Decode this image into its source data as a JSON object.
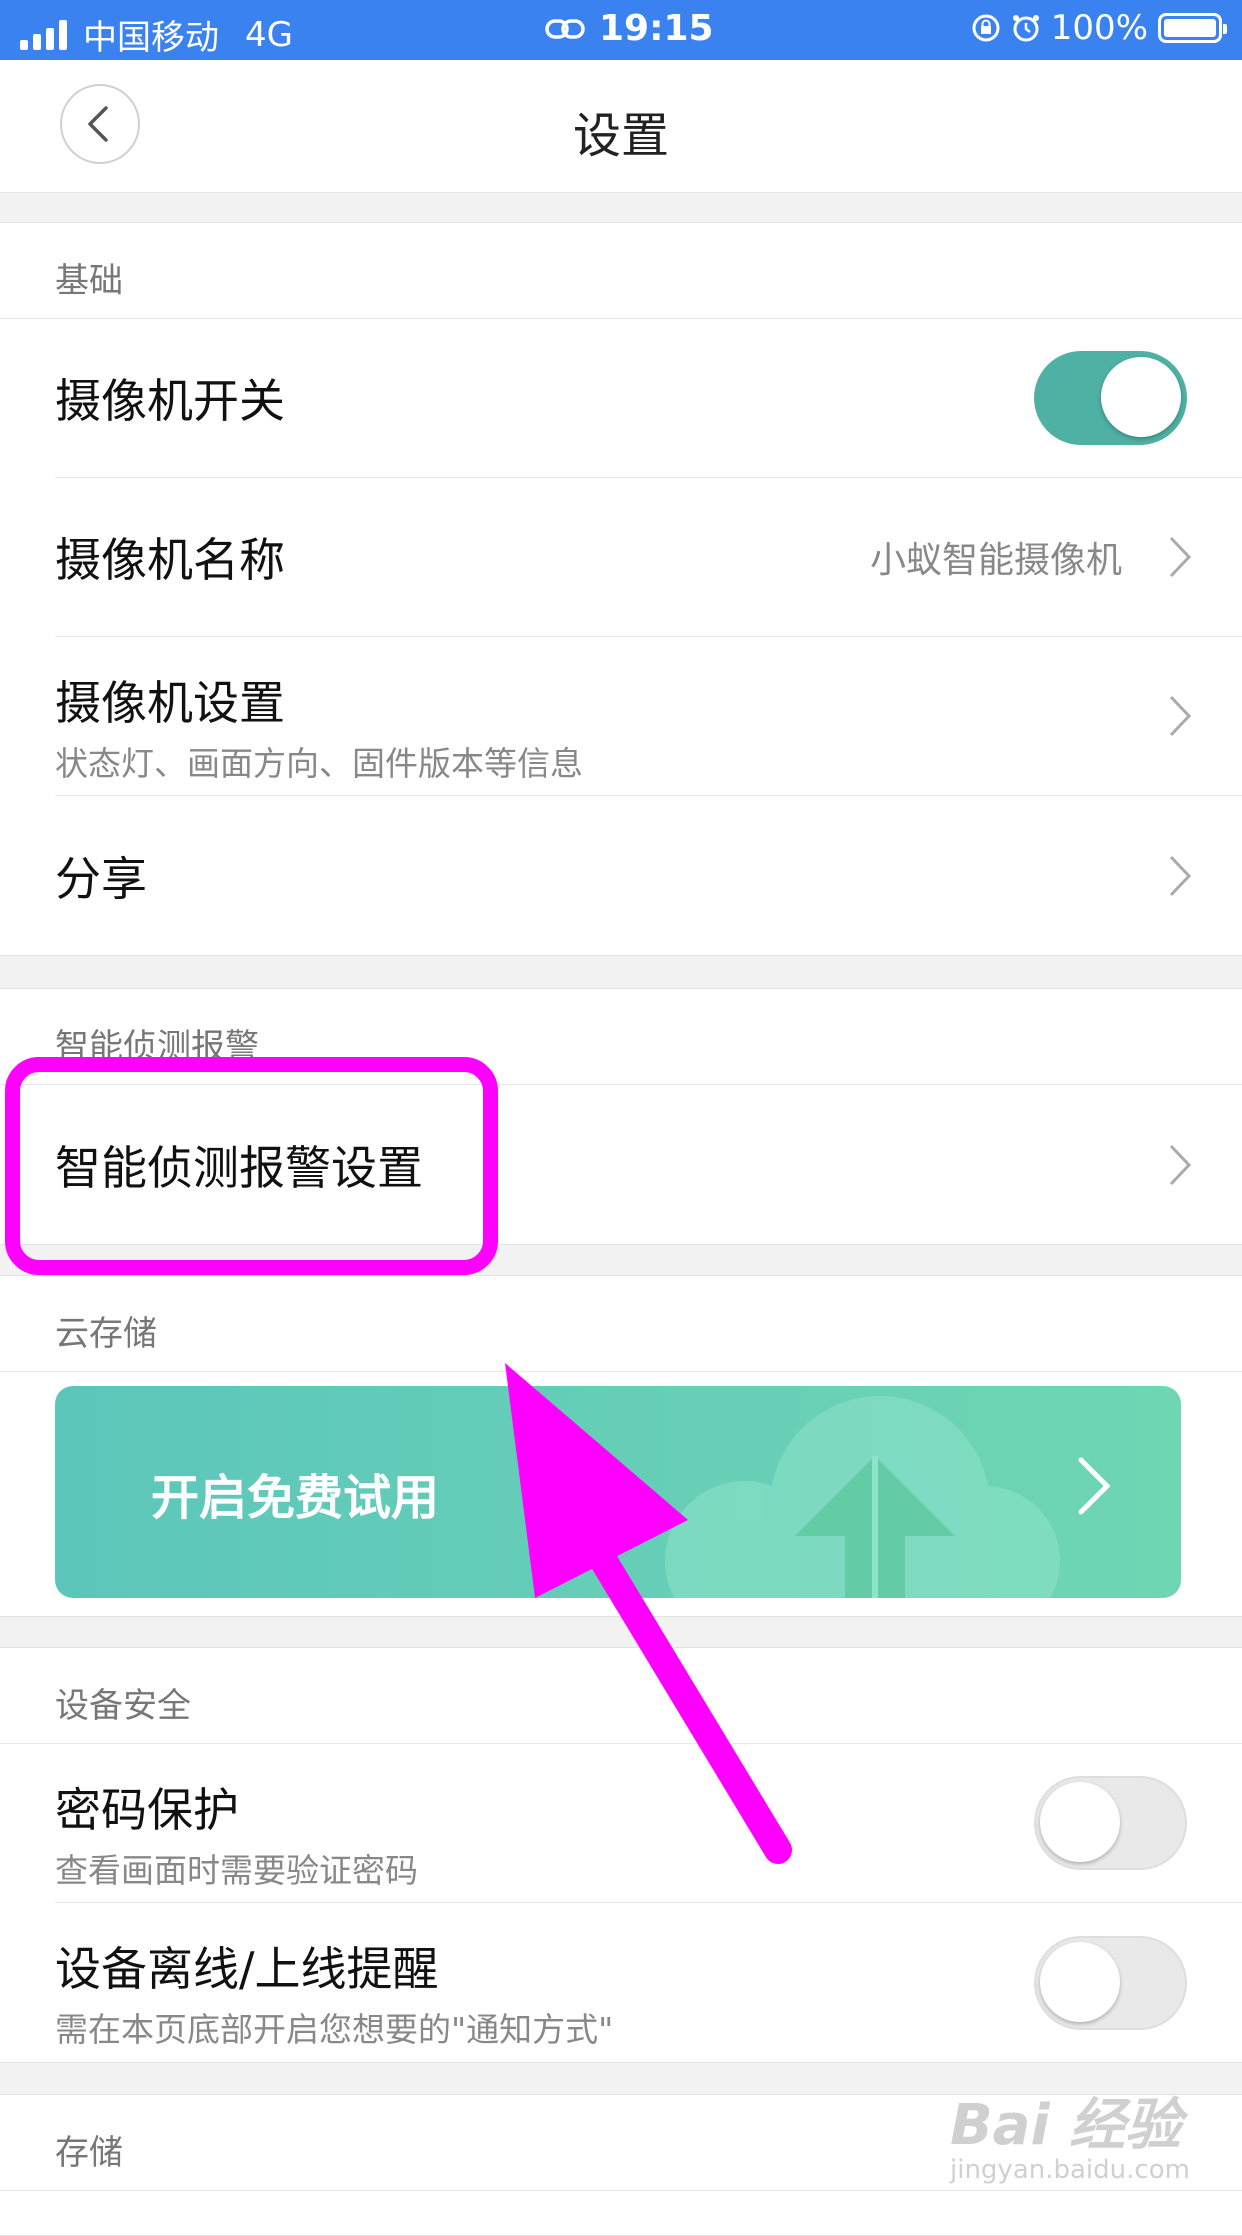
{
  "status_bar": {
    "carrier": "中国移动",
    "network": "4G",
    "time": "19:15",
    "battery": "100%"
  },
  "header": {
    "title": "设置"
  },
  "sections": {
    "basic": {
      "title": "基础",
      "camera_switch": {
        "label": "摄像机开关",
        "on": true
      },
      "camera_name": {
        "label": "摄像机名称",
        "value": "小蚁智能摄像机"
      },
      "camera_settings": {
        "label": "摄像机设置",
        "sub": "状态灯、画面方向、固件版本等信息"
      },
      "share": {
        "label": "分享"
      }
    },
    "detection": {
      "title": "智能侦测报警",
      "detection_settings": {
        "label": "智能侦测报警设置"
      }
    },
    "cloud": {
      "title": "云存储",
      "banner_label": "开启免费试用"
    },
    "security": {
      "title": "设备安全",
      "password": {
        "label": "密码保护",
        "sub": "查看画面时需要验证密码",
        "on": false
      },
      "offline_alert": {
        "label": "设备离线/上线提醒",
        "sub": "需在本页底部开启您想要的\"通知方式\"",
        "on": false
      }
    },
    "storage": {
      "title": "存储"
    }
  },
  "watermark": {
    "main": "Bai 经验",
    "sub": "jingyan.baidu.com"
  },
  "colors": {
    "status_bar": "#3b82f1",
    "toggle_on": "#4fb1a3",
    "banner_start": "#5cc6bb",
    "banner_end": "#6fd6b3",
    "annotation": "#ff00ff"
  }
}
